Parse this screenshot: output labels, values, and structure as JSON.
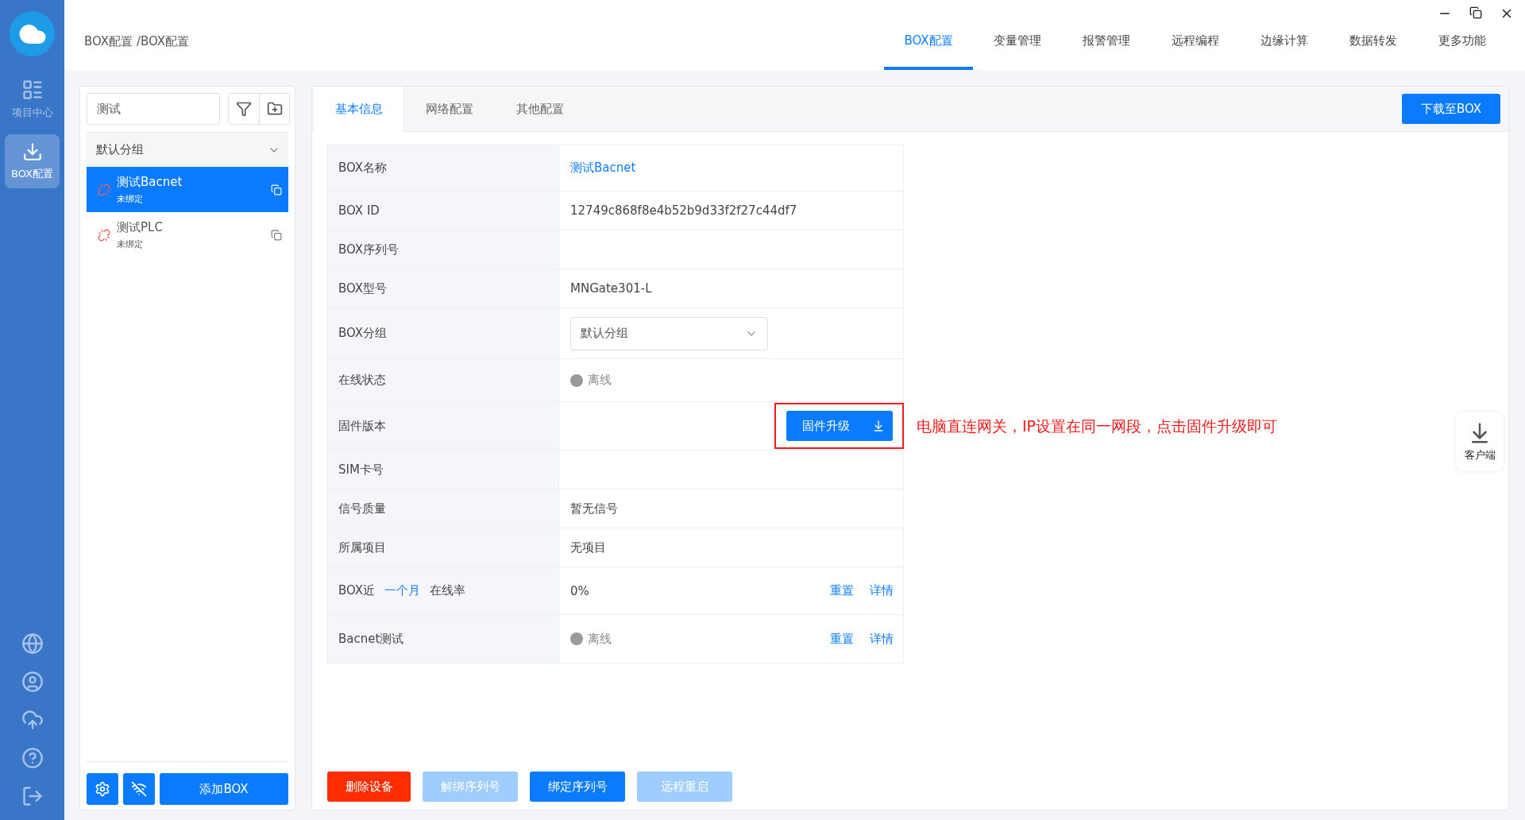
{
  "rail": {
    "items": [
      {
        "label": "项目中心",
        "selected": false
      },
      {
        "label": "BOX配置",
        "selected": true
      }
    ]
  },
  "breadcrumb": "BOX配置 /BOX配置",
  "tabs": [
    {
      "label": "BOX配置",
      "selected": true
    },
    {
      "label": "变量管理",
      "selected": false
    },
    {
      "label": "报警管理",
      "selected": false
    },
    {
      "label": "远程编程",
      "selected": false
    },
    {
      "label": "边缘计算",
      "selected": false
    },
    {
      "label": "数据转发",
      "selected": false
    },
    {
      "label": "更多功能",
      "selected": false
    }
  ],
  "sidebar": {
    "search": {
      "value": "测试"
    },
    "group": {
      "label": "默认分组",
      "expanded": true
    },
    "items": [
      {
        "name": "测试Bacnet",
        "status": "未绑定",
        "selected": true
      },
      {
        "name": "测试PLC",
        "status": "未绑定",
        "selected": false
      }
    ],
    "add_button": "添加BOX"
  },
  "subtabs": [
    {
      "label": "基本信息",
      "selected": true
    },
    {
      "label": "网络配置",
      "selected": false
    },
    {
      "label": "其他配置",
      "selected": false
    }
  ],
  "download_button": "下载至BOX",
  "rows": [
    {
      "kind": "link",
      "label": "BOX名称",
      "value": "测试Bacnet"
    },
    {
      "kind": "text",
      "label": "BOX ID",
      "value": "12749c868f8e4b52b9d33f2f27c44df7"
    },
    {
      "kind": "text",
      "label": "BOX序列号"
    },
    {
      "kind": "text",
      "label": "BOX型号",
      "value": "MNGate301-L"
    },
    {
      "kind": "select",
      "label": "BOX分组",
      "value": "默认分组"
    },
    {
      "kind": "status",
      "label": "在线状态",
      "value": "离线",
      "online": false
    },
    {
      "kind": "button",
      "label": "固件版本",
      "button": "固件升级",
      "highlighted": true,
      "callout": "电脑直连网关，IP设置在同一网段，点击固件升级即可"
    },
    {
      "kind": "text",
      "label": "SIM卡号"
    },
    {
      "kind": "text",
      "label": "信号质量",
      "value": "暂无信号"
    },
    {
      "kind": "text",
      "label": "所属项目",
      "value": "无项目"
    },
    {
      "kind": "text",
      "label_parts": [
        {
          "text": "BOX近",
          "link": false
        },
        {
          "text": "一个月",
          "link": true
        },
        {
          "text": "在线率",
          "link": false
        }
      ],
      "value": "0%",
      "actions": [
        "重置",
        "详情"
      ]
    },
    {
      "kind": "status",
      "label": "Bacnet测试",
      "value": "离线",
      "online": false,
      "actions": [
        "重置",
        "详情"
      ]
    }
  ],
  "actions": [
    {
      "label": "删除设备",
      "kind": "danger",
      "disabled": false
    },
    {
      "label": "解绑序列号",
      "kind": "primary",
      "disabled": true
    },
    {
      "label": "绑定序列号",
      "kind": "primary",
      "disabled": false
    },
    {
      "label": "远程重启",
      "kind": "primary",
      "disabled": true
    }
  ],
  "client_button": "客户端"
}
